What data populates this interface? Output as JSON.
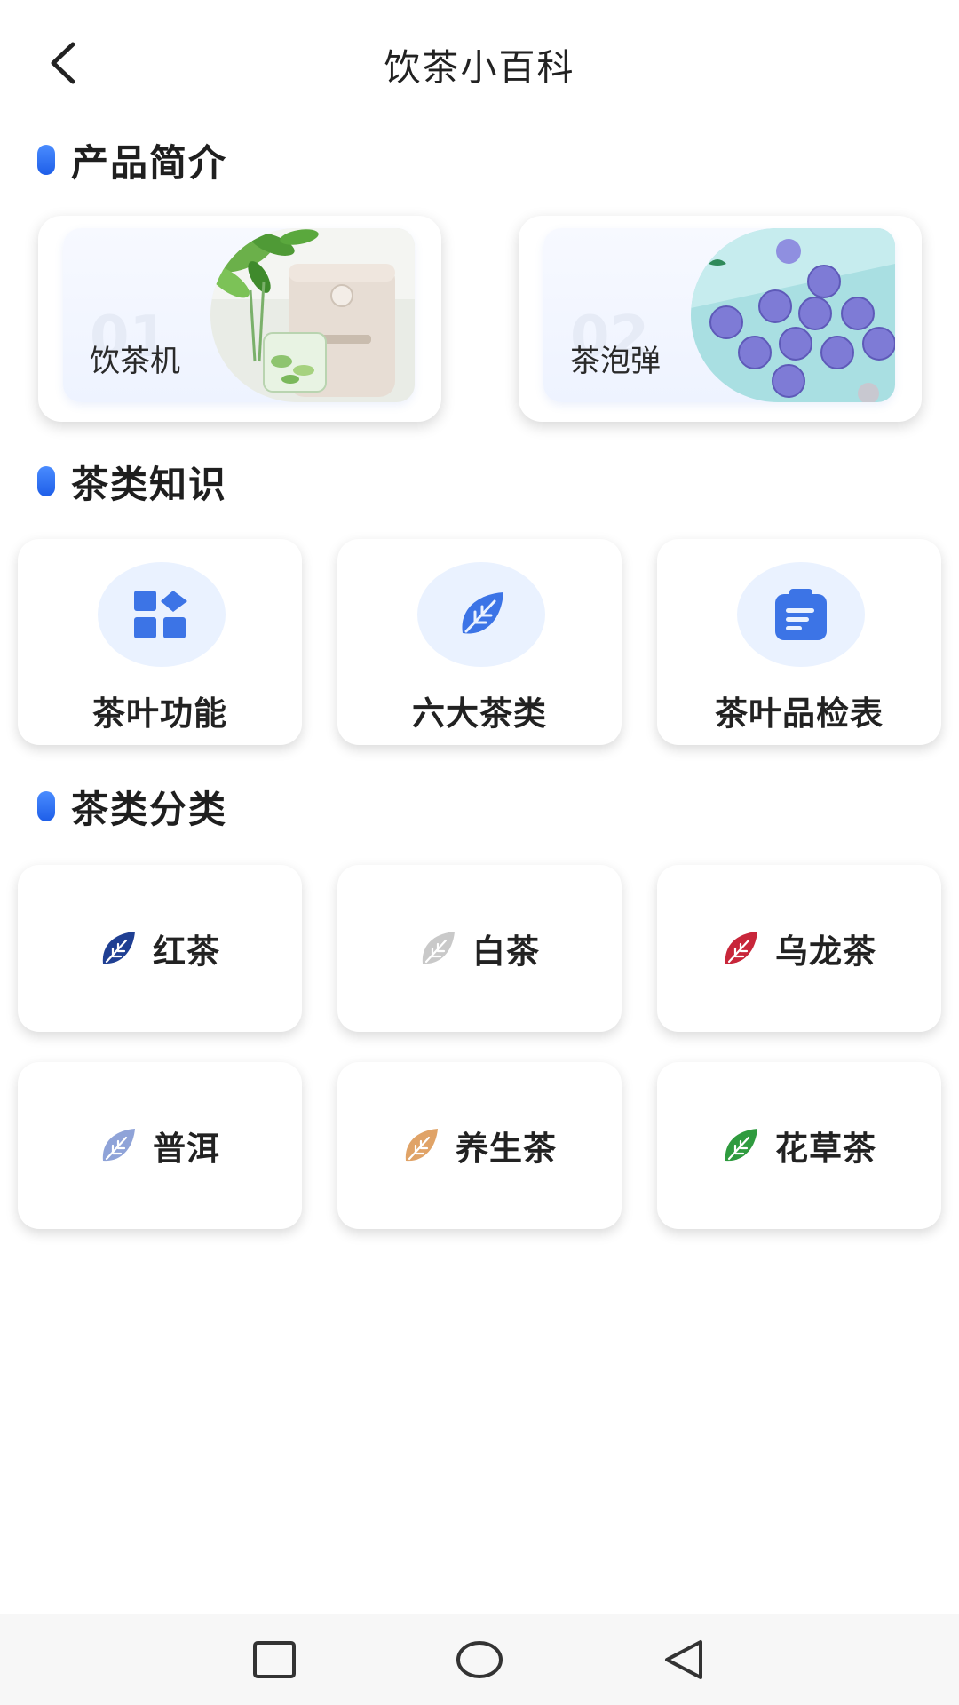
{
  "header": {
    "title": "饮茶小百科"
  },
  "sections": {
    "products": "产品简介",
    "knowledge": "茶类知识",
    "classify": "茶类分类"
  },
  "products": [
    {
      "num": "01",
      "label": "饮茶机"
    },
    {
      "num": "02",
      "label": "茶泡弹"
    }
  ],
  "knowledge": [
    {
      "label": "茶叶功能",
      "icon": "grid-icon"
    },
    {
      "label": "六大茶类",
      "icon": "leaf-icon"
    },
    {
      "label": "茶叶品检表",
      "icon": "clipboard-icon"
    }
  ],
  "teas": [
    {
      "label": "红茶",
      "color": "#1f3f93"
    },
    {
      "label": "白茶",
      "color": "#c9c9c9"
    },
    {
      "label": "乌龙茶",
      "color": "#c8263a"
    },
    {
      "label": "普洱",
      "color": "#8fa3d8"
    },
    {
      "label": "养生茶",
      "color": "#e0a367"
    },
    {
      "label": "花草茶",
      "color": "#2f9b3f"
    }
  ],
  "colors": {
    "accent": "#2f6ef0",
    "icon_bg": "#eaf2ff"
  }
}
